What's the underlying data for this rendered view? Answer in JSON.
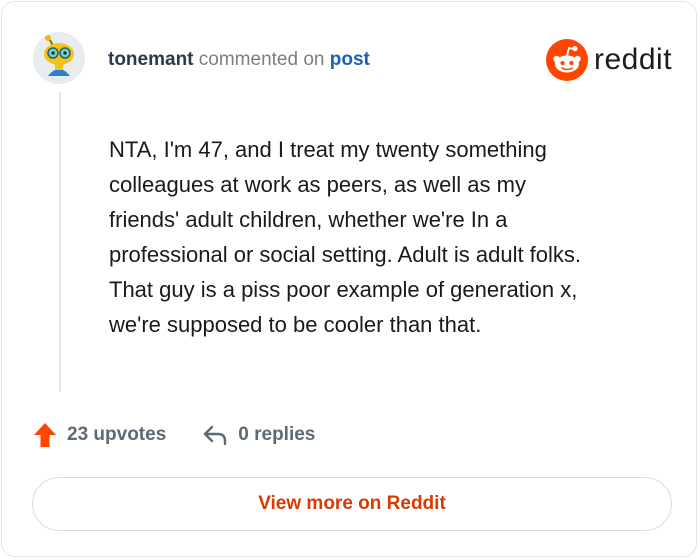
{
  "comment": {
    "username": "tonemant",
    "action_text": "commented on",
    "post_link": "post",
    "body_lines": [
      "NTA, I'm 47, and I treat my twenty something",
      "colleagues at work as peers, as well as my",
      "friends' adult children, whether we're In a",
      "professional or social setting. Adult is adult folks.",
      "That guy is a piss poor example of generation x,",
      "we're supposed to be cooler than that."
    ]
  },
  "brand": {
    "name": "reddit",
    "color": "#ff4500"
  },
  "stats": {
    "upvotes": "23 upvotes",
    "replies": "0 replies",
    "upvote_icon": "arrow-up-icon",
    "reply_icon": "reply-arrow-icon"
  },
  "cta": {
    "label": "View more on Reddit"
  },
  "colors": {
    "accent": "#d93a00",
    "link": "#1a5ec0",
    "upvote": "#ff4500"
  }
}
